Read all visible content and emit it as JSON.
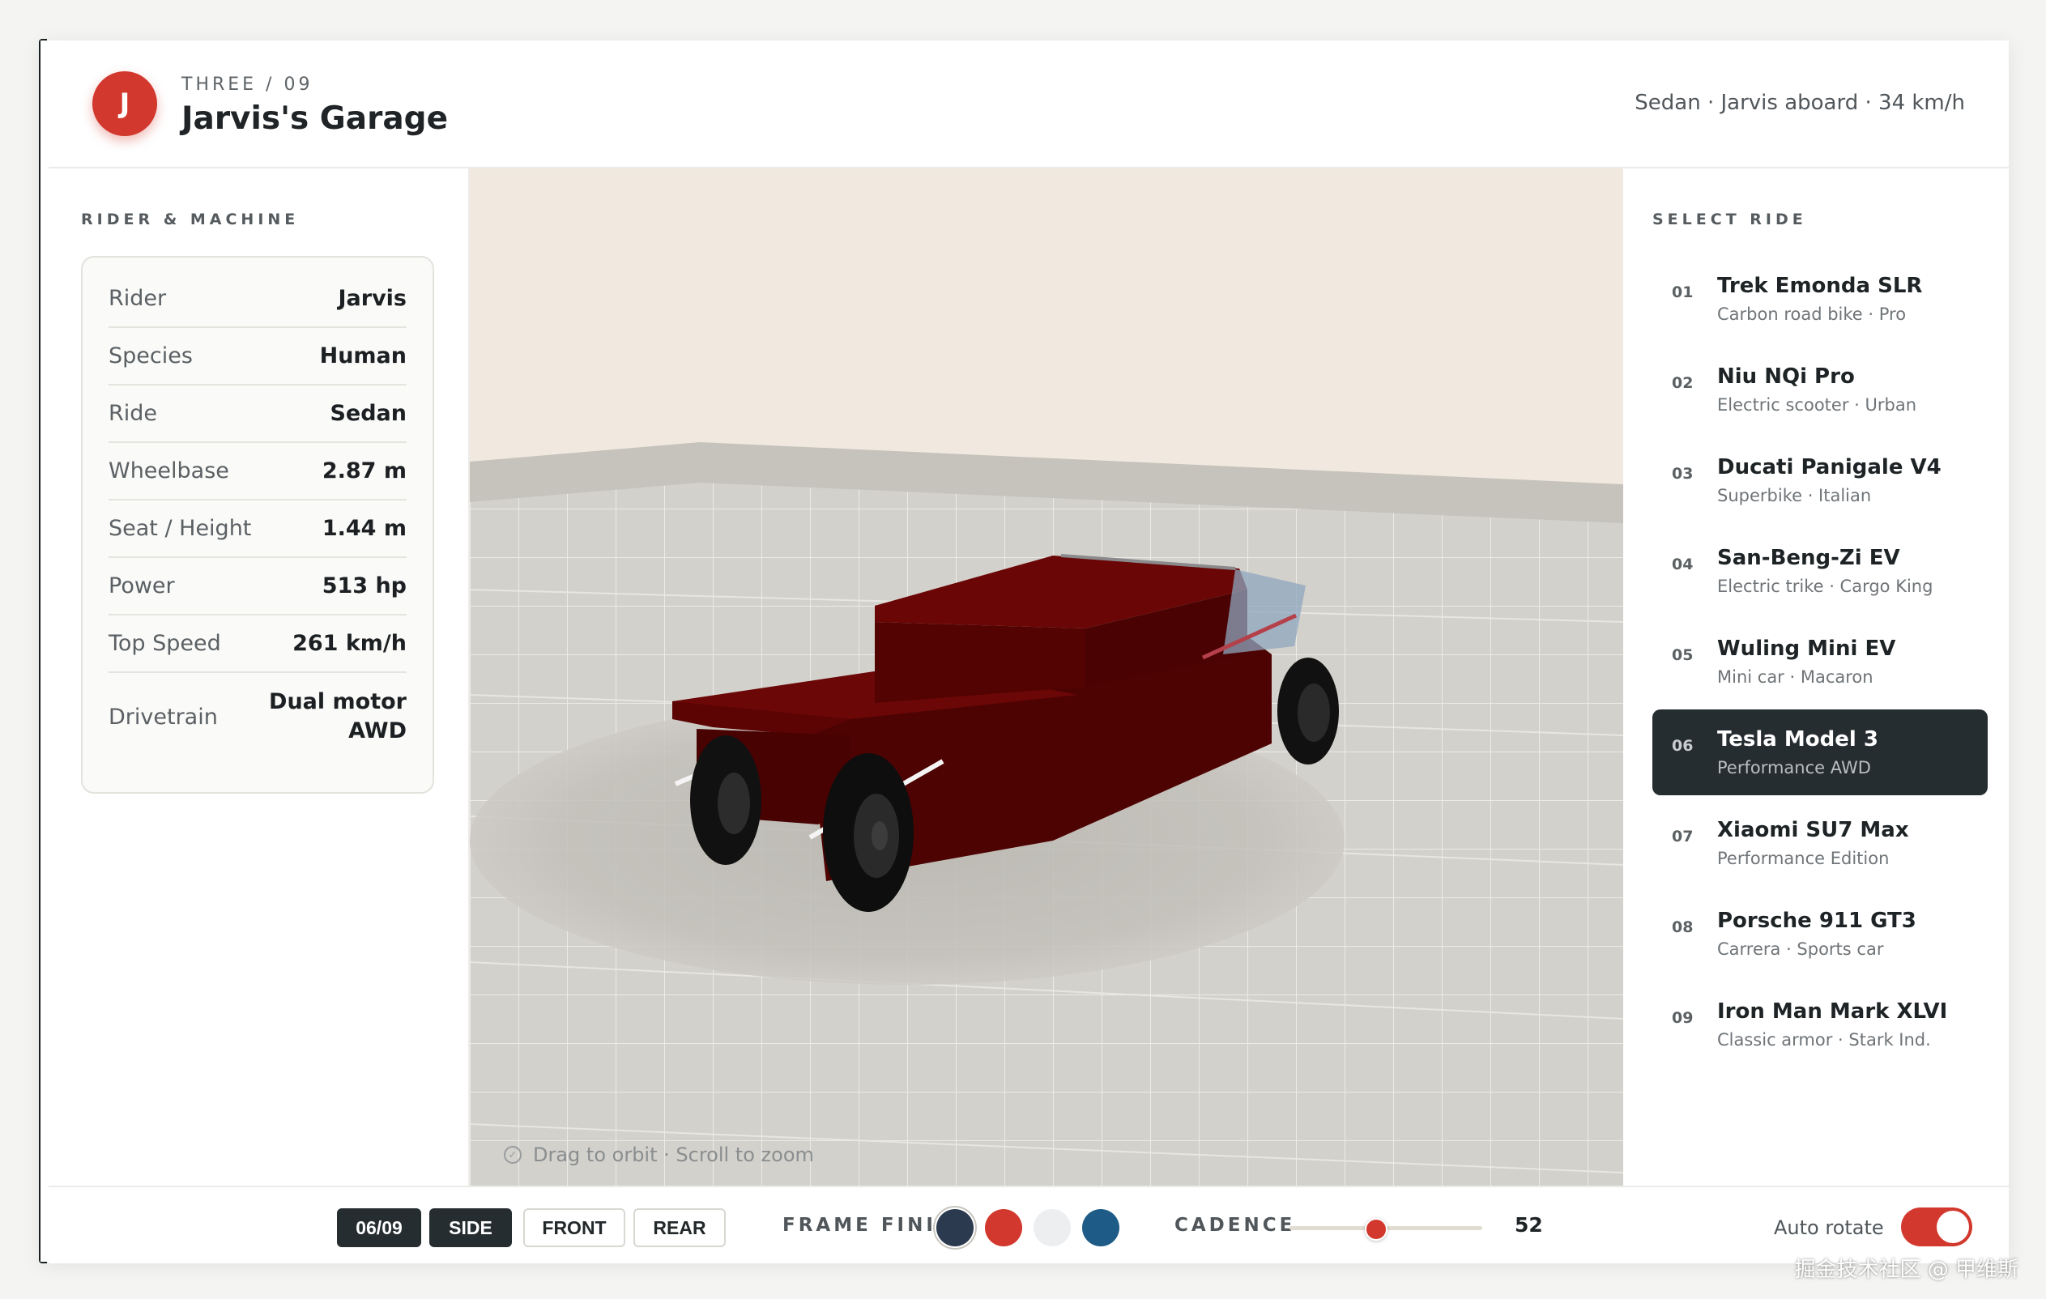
{
  "header": {
    "avatar_initial": "J",
    "eyebrow": "THREE / 09",
    "title": "Jarvis's Garage",
    "status": "Sedan · Jarvis aboard · 34 km/h"
  },
  "left_panel": {
    "section_label": "RIDER & MACHINE",
    "specs": [
      {
        "key": "Rider",
        "value": "Jarvis"
      },
      {
        "key": "Species",
        "value": "Human"
      },
      {
        "key": "Ride",
        "value": "Sedan"
      },
      {
        "key": "Wheelbase",
        "value": "2.87 m"
      },
      {
        "key": "Seat / Height",
        "value": "1.44 m"
      },
      {
        "key": "Power",
        "value": "513 hp"
      },
      {
        "key": "Top Speed",
        "value": "261 km/h"
      },
      {
        "key": "Drivetrain",
        "value_line1": "Dual motor",
        "value_line2": "AWD"
      }
    ]
  },
  "viewport": {
    "hint": "Drag to orbit · Scroll to zoom"
  },
  "right_panel": {
    "section_label": "SELECT RIDE",
    "rides": [
      {
        "num": "01",
        "name": "Trek Emonda SLR",
        "sub": "Carbon road bike · Pro"
      },
      {
        "num": "02",
        "name": "Niu NQi Pro",
        "sub": "Electric scooter · Urban"
      },
      {
        "num": "03",
        "name": "Ducati Panigale V4",
        "sub": "Superbike · Italian"
      },
      {
        "num": "04",
        "name": "San-Beng-Zi EV",
        "sub": "Electric trike · Cargo King"
      },
      {
        "num": "05",
        "name": "Wuling Mini EV",
        "sub": "Mini car · Macaron"
      },
      {
        "num": "06",
        "name": "Tesla Model 3",
        "sub": "Performance AWD",
        "active": true
      },
      {
        "num": "07",
        "name": "Xiaomi SU7 Max",
        "sub": "Performance Edition"
      },
      {
        "num": "08",
        "name": "Porsche 911 GT3",
        "sub": "Carrera · Sports car"
      },
      {
        "num": "09",
        "name": "Iron Man Mark XLVI",
        "sub": "Classic armor · Stark Ind."
      }
    ]
  },
  "bottombar": {
    "counter": "06/09",
    "views": [
      "SIDE",
      "FRONT",
      "REAR"
    ],
    "active_view": "SIDE",
    "frame_finish_label": "FRAME FINISH",
    "finishes": [
      "#2b3a4e",
      "#d2382d",
      "#eceeef",
      "#1e5b86"
    ],
    "cadence_label": "CADENCE",
    "cadence_value": "52",
    "cadence_fraction": 0.44,
    "auto_rotate_label": "Auto rotate",
    "auto_rotate_on": true
  },
  "watermark": "掘金技术社区 @ 甲维斯",
  "colors": {
    "accent": "#d2382d",
    "dark": "#262d31",
    "car_body": "#5e0505"
  }
}
